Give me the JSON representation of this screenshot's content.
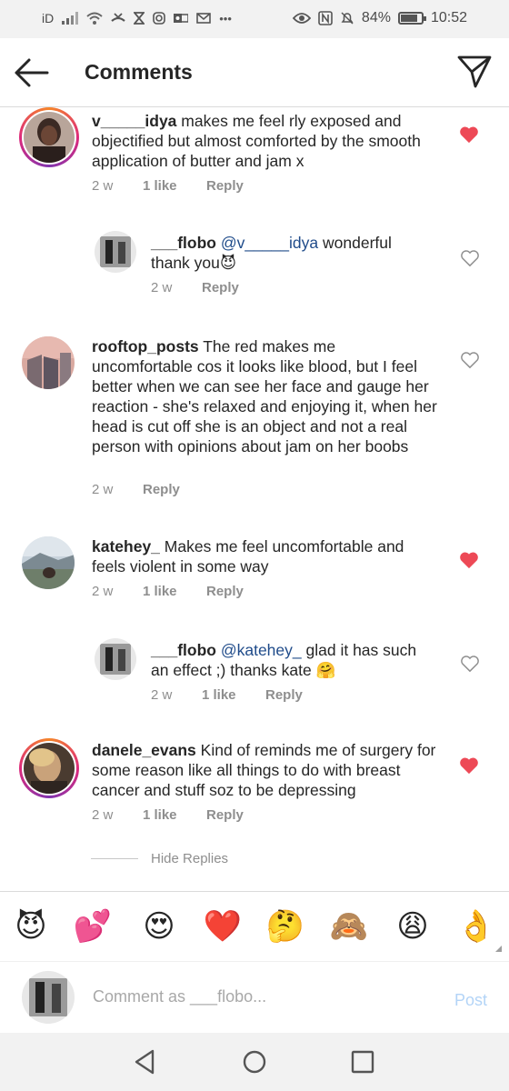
{
  "status_bar": {
    "carrier_label": "iD",
    "battery_percent": "84%",
    "battery_level": 0.84,
    "time": "10:52",
    "left_icons": [
      "signal-icon",
      "wifi-icon",
      "missed-call-icon",
      "hourglass-icon",
      "instagram-icon",
      "outlook-icon",
      "gmail-icon",
      "more-dots-icon"
    ],
    "right_icons": [
      "eye-icon",
      "nfc-icon",
      "mute-bell-icon",
      "battery-icon"
    ]
  },
  "header": {
    "title": "Comments"
  },
  "comments": [
    {
      "username": "v_____idya",
      "text": "makes me feel rly exposed and objectified but almost comforted by the smooth application of butter and jam x",
      "time": "2 w",
      "likes": "1 like",
      "reply_label": "Reply",
      "liked": true
    },
    {
      "username": "___flobo",
      "mention": "@v_____idya",
      "text": "wonderful thank you😈",
      "time": "2 w",
      "likes": "",
      "reply_label": "Reply",
      "liked": false
    },
    {
      "username": "rooftop_posts",
      "text": "The red makes me uncomfortable cos it looks like blood, but I feel better when we can see her face and gauge her reaction - she's relaxed and enjoying it, when her head is cut off she is an object and not a real person with opinions about jam on her boobs",
      "time": "2 w",
      "likes": "",
      "reply_label": "Reply",
      "liked": false
    },
    {
      "username": "katehey_",
      "text": "Makes me feel uncomfortable and feels violent in some way",
      "time": "2 w",
      "likes": "1 like",
      "reply_label": "Reply",
      "liked": true
    },
    {
      "username": "___flobo",
      "mention": "@katehey_",
      "text": "glad it has such an effect ;) thanks kate 🤗",
      "time": "2 w",
      "likes": "1 like",
      "reply_label": "Reply",
      "liked": false
    },
    {
      "username": "danele_evans",
      "text": "Kind of reminds me of surgery for some reason like all things to do with breast cancer and stuff soz to be depressing",
      "time": "2 w",
      "likes": "1 like",
      "reply_label": "Reply",
      "liked": true
    }
  ],
  "hide_replies_label": "Hide Replies",
  "emoji_bar": [
    "😈",
    "💕",
    "😍",
    "❤️",
    "🤔",
    "🙈",
    "😩",
    "👌"
  ],
  "comment_input": {
    "placeholder": "Comment as ___flobo...",
    "value": ""
  },
  "post_label": "Post",
  "colors": {
    "heart_liked": "#ed4956",
    "mention": "#1f4b8a",
    "post_disabled": "#b3d4f7",
    "meta_gray": "#8e8e8e"
  }
}
